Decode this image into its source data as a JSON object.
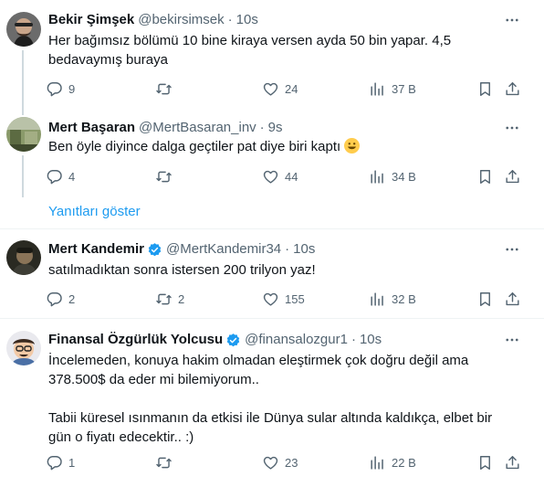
{
  "tweets": [
    {
      "name": "Bekir Şimşek",
      "handle": "@bekirsimsek",
      "time": "10s",
      "verified": false,
      "text": "Her bağımsız bölümü 10 bine kiraya versen ayda 50 bin yapar. 4,5 bedavaymış buraya",
      "replies": "9",
      "retweets": "",
      "likes": "24",
      "views": "37 B"
    },
    {
      "name": "Mert Başaran",
      "handle": "@MertBasaran_inv",
      "time": "9s",
      "verified": false,
      "text": "Ben öyle diyince dalga geçtiler pat diye biri kaptı",
      "replies": "4",
      "retweets": "",
      "likes": "44",
      "views": "34 B"
    },
    {
      "name": "Mert Kandemir",
      "handle": "@MertKandemir34",
      "time": "10s",
      "verified": true,
      "text": "satılmadıktan sonra istersen 200 trilyon yaz!",
      "replies": "2",
      "retweets": "2",
      "likes": "155",
      "views": "32 B"
    },
    {
      "name": "Finansal Özgürlük Yolcusu",
      "handle": "@finansalozgur1",
      "time": "10s",
      "verified": true,
      "text": "İncelemeden, konuya hakim olmadan eleştirmek çok doğru değil ama 378.500$ da eder mi bilemiyorum..\n\nTabii küresel ısınmanın da etkisi ile Dünya sular altında kaldıkça, elbet bir gün o fiyatı edecektir.. :)",
      "replies": "1",
      "retweets": "",
      "likes": "23",
      "views": "22 B"
    }
  ],
  "show_replies": "Yanıtları göster",
  "colors": {
    "accent": "#1d9bf0",
    "muted": "#536471",
    "text": "#0f1419",
    "divider": "#eff3f4",
    "thread_line": "#cfd9de"
  },
  "icons": [
    "more-icon",
    "reply-icon",
    "retweet-icon",
    "like-icon",
    "views-icon",
    "bookmark-icon",
    "share-icon",
    "verified-badge-icon",
    "smile-emoji-icon"
  ]
}
